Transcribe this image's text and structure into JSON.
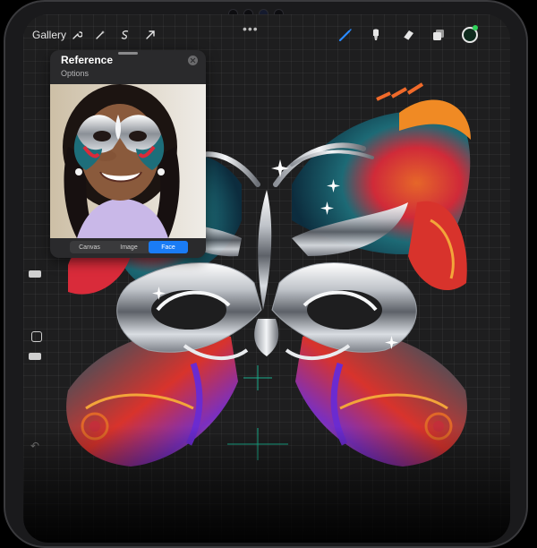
{
  "topbar": {
    "gallery_label": "Gallery",
    "more_label": "•••",
    "left_tools": [
      "wrench-icon",
      "magic-wand-icon",
      "selection-icon",
      "transform-arrow-icon"
    ],
    "right_tools": [
      "brush-icon",
      "smudge-icon",
      "eraser-icon",
      "layers-icon"
    ],
    "active_tool": "brush",
    "accent_color": "#2a8bff",
    "current_color": "#2fd25a"
  },
  "reference_panel": {
    "title": "Reference",
    "options_label": "Options",
    "tabs": [
      {
        "label": "Canvas",
        "active": false
      },
      {
        "label": "Image",
        "active": false
      },
      {
        "label": "Face",
        "active": true
      }
    ],
    "tab_active_color": "#1a7cf5"
  },
  "sidebar": {
    "items": [
      "brush-size-slider",
      "modify-button",
      "opacity-slider",
      "undo-icon"
    ]
  }
}
